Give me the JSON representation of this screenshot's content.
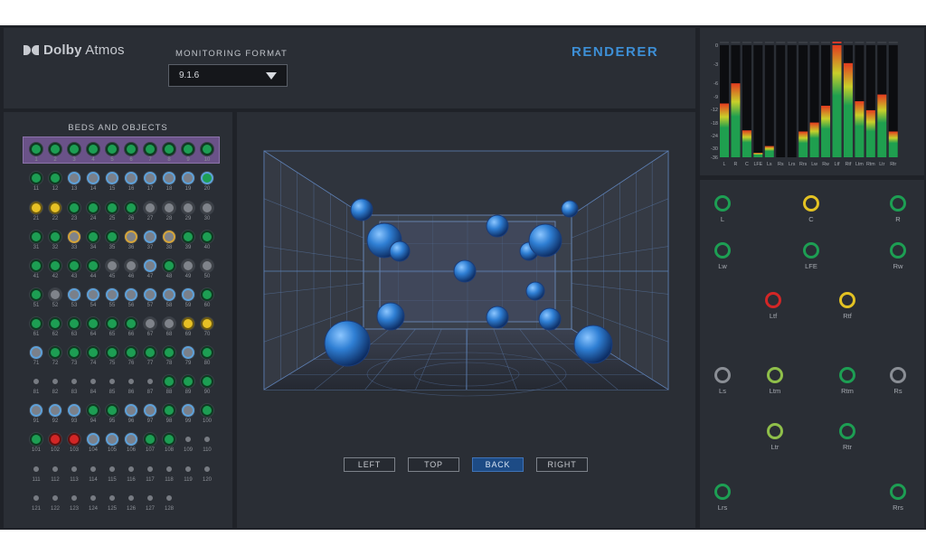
{
  "header": {
    "logo_bold": "Dolby",
    "logo_regular": "Atmos",
    "monitoring_label": "MONITORING FORMAT",
    "monitoring_value": "9.1.6",
    "title": "RENDERER"
  },
  "beds": {
    "title": "BEDS AND OBJECTS",
    "highlight_color": "#6a5288",
    "rows": [
      [
        "green",
        "green",
        "green",
        "green",
        "green",
        "green",
        "green",
        "green",
        "green",
        "green"
      ],
      [
        "green",
        "green",
        "bgray",
        "bgray",
        "bgray",
        "bgray",
        "bgray",
        "bgray",
        "bgray",
        "bgreen"
      ],
      [
        "yellow",
        "yellow",
        "green",
        "green",
        "green",
        "green",
        "gray",
        "gray",
        "gray",
        "gray"
      ],
      [
        "green",
        "green",
        "orange",
        "green",
        "green",
        "orange",
        "bgray",
        "orange",
        "green",
        "green"
      ],
      [
        "green",
        "green",
        "green",
        "green",
        "gray",
        "gray",
        "bgray",
        "green",
        "gray",
        "gray"
      ],
      [
        "green",
        "gray",
        "bgray",
        "bgray",
        "bgray",
        "bgray",
        "bgray",
        "bgray",
        "bgray",
        "green"
      ],
      [
        "green",
        "green",
        "green",
        "green",
        "green",
        "green",
        "gray",
        "gray",
        "yellow",
        "yellow"
      ],
      [
        "bgray",
        "green",
        "green",
        "green",
        "green",
        "green",
        "green",
        "green",
        "bgray",
        "green"
      ],
      [
        "off",
        "off",
        "off",
        "off",
        "off",
        "off",
        "off",
        "green",
        "green",
        "green"
      ],
      [
        "bgray",
        "bgray",
        "bgray",
        "green",
        "green",
        "bgray",
        "bgray",
        "green",
        "bgray",
        "green"
      ],
      [
        "green",
        "red",
        "red",
        "bgray",
        "bgray",
        "bgray",
        "green",
        "green",
        "off",
        "off"
      ],
      [
        "off",
        "off",
        "off",
        "off",
        "off",
        "off",
        "off",
        "off",
        "off",
        "off"
      ],
      [
        "off",
        "off",
        "off",
        "off",
        "off",
        "off",
        "off",
        "off"
      ]
    ]
  },
  "view": {
    "buttons": [
      "LEFT",
      "TOP",
      "BACK",
      "RIGHT"
    ],
    "active": "BACK",
    "object_color": "#2f7fd4"
  },
  "meter": {
    "scale": [
      "0",
      "-3",
      "-6",
      "-9",
      "-12",
      "-18",
      "-24",
      "-30",
      "-36"
    ],
    "channels": [
      "L",
      "R",
      "C",
      "LFE",
      "Ls",
      "Rs",
      "Lrs",
      "Rrs",
      "Lw",
      "Rw",
      "Ltf",
      "Rtf",
      "Ltm",
      "Rtm",
      "Ltr",
      "Rtr"
    ],
    "levels": [
      0.48,
      0.66,
      0.24,
      0.04,
      0.1,
      0,
      0,
      0.23,
      0.31,
      0.46,
      1.0,
      0.84,
      0.5,
      0.42,
      0.56,
      0.23
    ],
    "colors": {
      "low": "#1f9f4f",
      "mid": "#c8cf2a",
      "high": "#e33b1f"
    }
  },
  "speakers": [
    {
      "label": "L",
      "state": "green"
    },
    {
      "label": "C",
      "state": "yellow"
    },
    {
      "label": "R",
      "state": "green"
    },
    {
      "label": "Lw",
      "state": "green"
    },
    {
      "label": "LFE",
      "state": "green"
    },
    {
      "label": "Rw",
      "state": "green"
    },
    {
      "label": "Ltf",
      "state": "red"
    },
    {
      "label": "Rtf",
      "state": "yellow"
    },
    {
      "label": "Ls",
      "state": "gray"
    },
    {
      "label": "Ltm",
      "state": "lime"
    },
    {
      "label": "Rtm",
      "state": "green"
    },
    {
      "label": "Rs",
      "state": "gray"
    },
    {
      "label": "Ltr",
      "state": "lime"
    },
    {
      "label": "Rtr",
      "state": "green"
    },
    {
      "label": "Lrs",
      "state": "green"
    },
    {
      "label": "Rrs",
      "state": "green"
    }
  ]
}
